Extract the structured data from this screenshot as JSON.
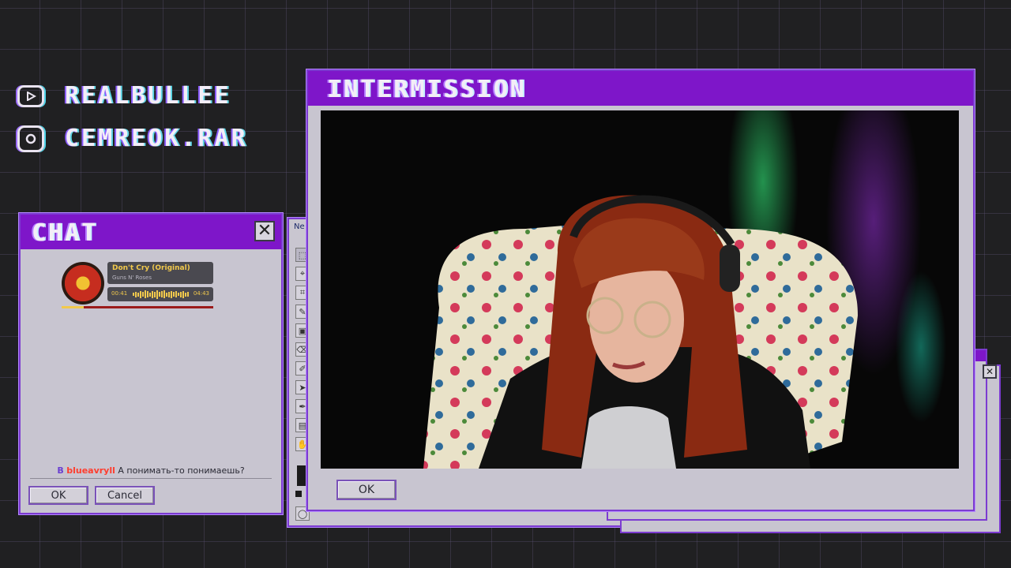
{
  "social": {
    "youtube": {
      "icon": "youtube-icon",
      "handle": "REALBULLEE"
    },
    "instagram": {
      "icon": "instagram-icon",
      "handle": "CEMREOK.RAR"
    }
  },
  "chat": {
    "title": "CHAT",
    "close_glyph": "✕",
    "player": {
      "song": "Don't Cry (Original)",
      "artist": "Guns N' Roses",
      "elapsed": "00:41",
      "duration": "04:43",
      "progress": 0.145
    },
    "message": {
      "badge": "B",
      "user": "blueavryll",
      "text": "А понимать-то понимаешь?"
    },
    "ok_label": "OK",
    "cancel_label": "Cancel"
  },
  "paint": {
    "title": "Ne"
  },
  "intermission": {
    "title": "INTERMISSION",
    "ok_label": "OK"
  },
  "colors": {
    "accent": "#7e16c9",
    "window_bg": "#c8c5d0",
    "grid_bg": "#202022",
    "progress": "#f2c94c",
    "username": "#ff3d2e"
  }
}
